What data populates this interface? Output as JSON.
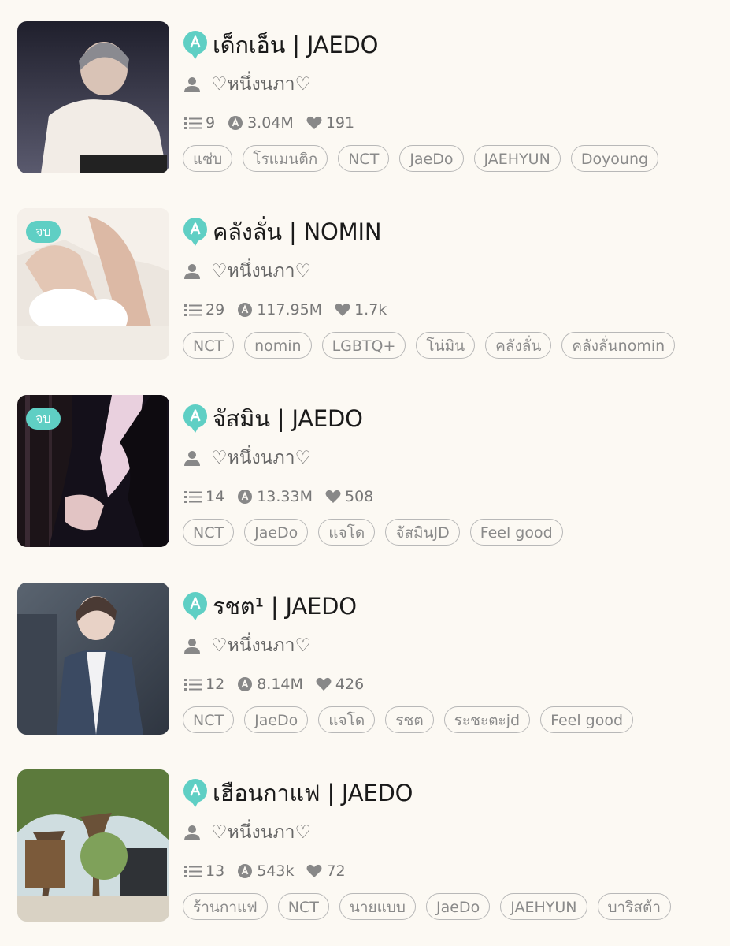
{
  "stories": [
    {
      "title": "เด็กเอ็น | JAEDO",
      "author": "♡หนึ่งนภา♡",
      "badge": "",
      "chapters": "9",
      "views": "3.04M",
      "likes": "191",
      "tags": [
        "แซ่บ",
        "โรแมนติก",
        "NCT",
        "JaeDo",
        "JAEHYUN",
        "Doyoung"
      ]
    },
    {
      "title": "คลังลั่น | NOMIN",
      "author": "♡หนึ่งนภา♡",
      "badge": "จบ",
      "chapters": "29",
      "views": "117.95M",
      "likes": "1.7k",
      "tags": [
        "NCT",
        "nomin",
        "LGBTQ+",
        "โน่มิน",
        "คลังลั่น",
        "คลังลั่นnomin"
      ]
    },
    {
      "title": "จัสมิน | JAEDO",
      "author": "♡หนึ่งนภา♡",
      "badge": "จบ",
      "chapters": "14",
      "views": "13.33M",
      "likes": "508",
      "tags": [
        "NCT",
        "JaeDo",
        "แจโด",
        "จัสมินJD",
        "Feel good"
      ]
    },
    {
      "title": "รชต¹ | JAEDO",
      "author": "♡หนึ่งนภา♡",
      "badge": "",
      "chapters": "12",
      "views": "8.14M",
      "likes": "426",
      "tags": [
        "NCT",
        "JaeDo",
        "แจโด",
        "รชต",
        "ระชะตะjd",
        "Feel good"
      ]
    },
    {
      "title": "เฮือนกาแฟ | JAEDO",
      "author": "♡หนึ่งนภา♡",
      "badge": "",
      "chapters": "13",
      "views": "543k",
      "likes": "72",
      "tags": [
        "ร้านกาแฟ",
        "NCT",
        "นายแบบ",
        "JaeDo",
        "JAEHYUN",
        "บาริสต้า"
      ]
    }
  ],
  "icons": {
    "brand": "a-speech-bubble-icon",
    "author": "person-icon",
    "chapters": "list-icon",
    "views": "eye-a-icon",
    "likes": "heart-icon"
  },
  "colors": {
    "background": "#fcf9f3",
    "accent": "#5fcfc4",
    "text": "#1a1a1a",
    "muted": "#777777"
  }
}
